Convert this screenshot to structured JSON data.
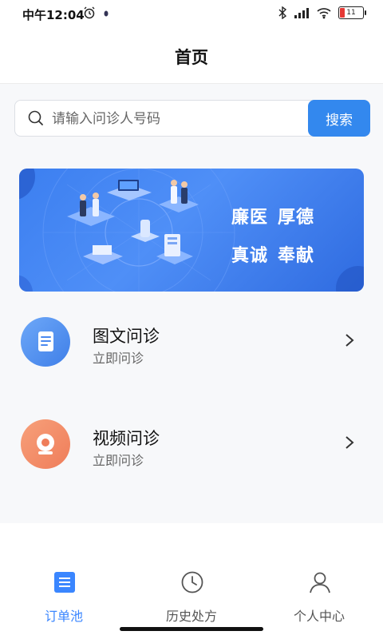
{
  "status_bar": {
    "time": "中午12:04",
    "battery_level": "11",
    "left_icons": [
      "alarm-icon",
      "notification-dot-icon"
    ],
    "right_icons": [
      "bluetooth-icon",
      "signal-icon",
      "wifi-icon",
      "battery-icon"
    ]
  },
  "header": {
    "title": "首页"
  },
  "search": {
    "placeholder": "请输入问诊人号码",
    "button_label": "搜索"
  },
  "banner": {
    "slogan": [
      "廉医",
      "厚德",
      "真诚",
      "奉献"
    ]
  },
  "services": [
    {
      "title": "图文问诊",
      "subtitle": "立即问诊",
      "icon": "document-icon",
      "color": "#4a89f0"
    },
    {
      "title": "视频问诊",
      "subtitle": "立即问诊",
      "icon": "camera-icon",
      "color": "#f08561"
    }
  ],
  "tabbar": {
    "items": [
      {
        "label": "订单池",
        "icon": "list-icon",
        "active": true
      },
      {
        "label": "历史处方",
        "icon": "clock-icon",
        "active": false
      },
      {
        "label": "个人中心",
        "icon": "person-icon",
        "active": false
      }
    ]
  },
  "colors": {
    "accent": "#3388ee",
    "active_tab": "#3a86ff"
  }
}
